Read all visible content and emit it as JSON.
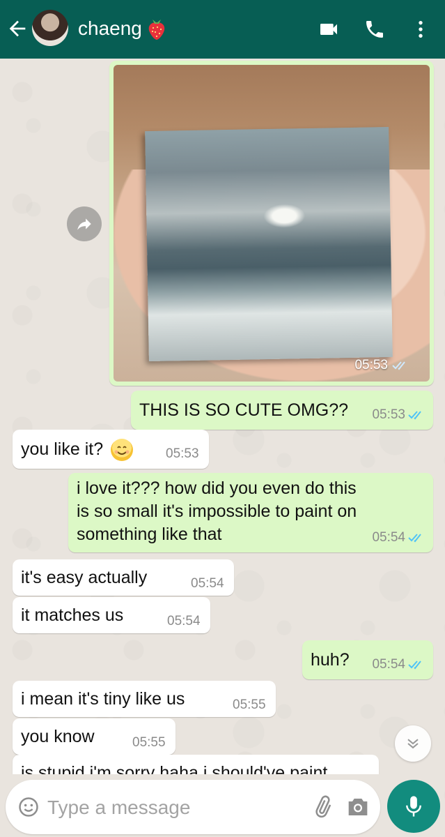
{
  "header": {
    "contact_name": "chaeng",
    "name_emoji": "strawberry-icon",
    "icons": [
      "back-arrow-icon",
      "video-call-icon",
      "phone-icon",
      "more-vert-icon"
    ]
  },
  "colors": {
    "header_bg": "#075e54",
    "outgoing_bubble": "#dcf8c6",
    "incoming_bubble": "#ffffff",
    "read_ticks": "#4fc3f7",
    "mic_button": "#128c7e"
  },
  "messages": [
    {
      "id": "m0",
      "direction": "out",
      "type": "image",
      "time": "05:53",
      "status": "read"
    },
    {
      "id": "m1",
      "direction": "out",
      "text": "THIS IS SO CUTE OMG??",
      "time": "05:53",
      "status": "read"
    },
    {
      "id": "m2",
      "direction": "in",
      "text": "you like it?",
      "emoji": "smiling-face",
      "time": "05:53"
    },
    {
      "id": "m3",
      "direction": "out",
      "lines": [
        "i love it??? how did you even do this",
        "is so small it's impossible to paint on",
        "something like that"
      ],
      "time": "05:54",
      "status": "read"
    },
    {
      "id": "m4",
      "direction": "in",
      "text": "it's easy actually",
      "time": "05:54"
    },
    {
      "id": "m5",
      "direction": "in",
      "text": "it matches us",
      "time": "05:54"
    },
    {
      "id": "m6",
      "direction": "out",
      "text": "huh?",
      "time": "05:54",
      "status": "read"
    },
    {
      "id": "m7",
      "direction": "in",
      "text": "i mean it's tiny like us",
      "time": "05:55"
    },
    {
      "id": "m8",
      "direction": "in",
      "text": "you know",
      "time": "05:55"
    },
    {
      "id": "m9",
      "direction": "in",
      "text": "is stupid i'm sorry haha i should've paint"
    }
  ],
  "composer": {
    "placeholder": "Type a message",
    "value": ""
  }
}
